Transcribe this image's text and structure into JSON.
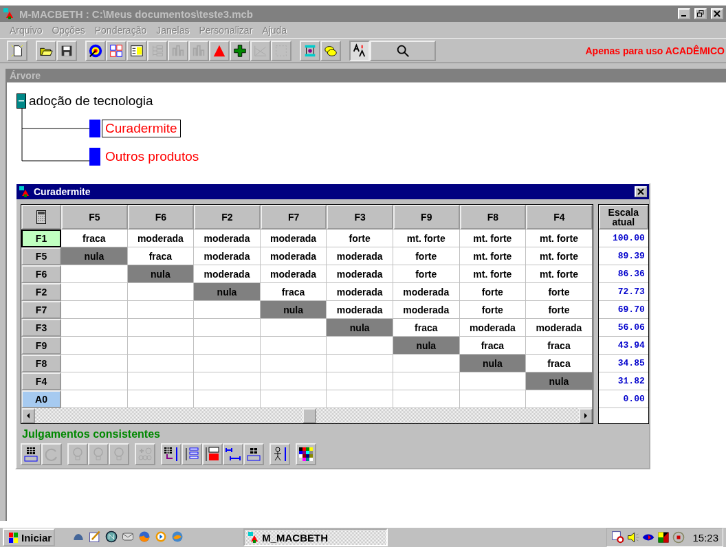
{
  "window": {
    "title": "M-MACBETH : C:\\Meus documentos\\teste3.mcb"
  },
  "menu": [
    "Arquivo",
    "Opções",
    "Ponderação",
    "Janelas",
    "Personalizar",
    "Ajuda"
  ],
  "toolbar": [
    {
      "kind": "new",
      "disabled": false
    },
    {
      "kind": "sep"
    },
    {
      "kind": "open",
      "disabled": false
    },
    {
      "kind": "save",
      "disabled": false
    },
    {
      "kind": "sep"
    },
    {
      "kind": "target",
      "disabled": false
    },
    {
      "kind": "ab",
      "disabled": false
    },
    {
      "kind": "table",
      "disabled": false
    },
    {
      "kind": "tree",
      "disabled": true
    },
    {
      "kind": "bars",
      "disabled": true
    },
    {
      "kind": "bars",
      "disabled": true
    },
    {
      "kind": "triangle",
      "disabled": false
    },
    {
      "kind": "plus",
      "disabled": false
    },
    {
      "kind": "chart",
      "disabled": true
    },
    {
      "kind": "dots",
      "disabled": true
    },
    {
      "kind": "sep"
    },
    {
      "kind": "help",
      "disabled": false
    },
    {
      "kind": "coins",
      "disabled": false
    },
    {
      "kind": "sep"
    },
    {
      "kind": "font",
      "disabled": false
    },
    {
      "kind": "search",
      "disabled": false
    }
  ],
  "notice": "Apenas para uso ACADÊMICO",
  "tree_panel": {
    "title": "Árvore",
    "root": {
      "label": "adoção de tecnologia",
      "expanded": true,
      "children": [
        {
          "label": "Curadermite",
          "selected": true
        },
        {
          "label": "Outros produtos",
          "selected": false
        }
      ]
    }
  },
  "matrix_window": {
    "title": "Curadermite",
    "columns": [
      "F5",
      "F6",
      "F2",
      "F7",
      "F3",
      "F9",
      "F8",
      "F4"
    ],
    "scale_header": "Escala atual",
    "rows": [
      {
        "label": "F1",
        "kind": "active",
        "cells": [
          {
            "text": "fraca",
            "kind": "value"
          },
          {
            "text": "moderada",
            "kind": "value"
          },
          {
            "text": "moderada",
            "kind": "value"
          },
          {
            "text": "moderada",
            "kind": "value"
          },
          {
            "text": "forte",
            "kind": "value"
          },
          {
            "text": "mt. forte",
            "kind": "value"
          },
          {
            "text": "mt. forte",
            "kind": "value"
          },
          {
            "text": "mt. forte",
            "kind": "value"
          }
        ],
        "scale": "100.00"
      },
      {
        "label": "F5",
        "kind": "normal",
        "cells": [
          {
            "text": "nula",
            "kind": "diagonal"
          },
          {
            "text": "fraca",
            "kind": "value"
          },
          {
            "text": "moderada",
            "kind": "value"
          },
          {
            "text": "moderada",
            "kind": "value"
          },
          {
            "text": "moderada",
            "kind": "value"
          },
          {
            "text": "forte",
            "kind": "value"
          },
          {
            "text": "mt. forte",
            "kind": "value"
          },
          {
            "text": "mt. forte",
            "kind": "value"
          }
        ],
        "scale": "89.39"
      },
      {
        "label": "F6",
        "kind": "normal",
        "cells": [
          {
            "kind": "blank"
          },
          {
            "text": "nula",
            "kind": "diagonal"
          },
          {
            "text": "moderada",
            "kind": "value"
          },
          {
            "text": "moderada",
            "kind": "value"
          },
          {
            "text": "moderada",
            "kind": "value"
          },
          {
            "text": "forte",
            "kind": "value"
          },
          {
            "text": "mt. forte",
            "kind": "value"
          },
          {
            "text": "mt. forte",
            "kind": "value"
          }
        ],
        "scale": "86.36"
      },
      {
        "label": "F2",
        "kind": "normal",
        "cells": [
          {
            "kind": "blank"
          },
          {
            "kind": "blank"
          },
          {
            "text": "nula",
            "kind": "diagonal"
          },
          {
            "text": "fraca",
            "kind": "value"
          },
          {
            "text": "moderada",
            "kind": "value"
          },
          {
            "text": "moderada",
            "kind": "value"
          },
          {
            "text": "forte",
            "kind": "value"
          },
          {
            "text": "forte",
            "kind": "value"
          }
        ],
        "scale": "72.73"
      },
      {
        "label": "F7",
        "kind": "normal",
        "cells": [
          {
            "kind": "blank"
          },
          {
            "kind": "blank"
          },
          {
            "kind": "blank"
          },
          {
            "text": "nula",
            "kind": "diagonal"
          },
          {
            "text": "moderada",
            "kind": "value"
          },
          {
            "text": "moderada",
            "kind": "value"
          },
          {
            "text": "forte",
            "kind": "value"
          },
          {
            "text": "forte",
            "kind": "value"
          }
        ],
        "scale": "69.70"
      },
      {
        "label": "F3",
        "kind": "normal",
        "cells": [
          {
            "kind": "blank"
          },
          {
            "kind": "blank"
          },
          {
            "kind": "blank"
          },
          {
            "kind": "blank"
          },
          {
            "text": "nula",
            "kind": "diagonal"
          },
          {
            "text": "fraca",
            "kind": "value"
          },
          {
            "text": "moderada",
            "kind": "value"
          },
          {
            "text": "moderada",
            "kind": "value"
          }
        ],
        "scale": "56.06"
      },
      {
        "label": "F9",
        "kind": "normal",
        "cells": [
          {
            "kind": "blank"
          },
          {
            "kind": "blank"
          },
          {
            "kind": "blank"
          },
          {
            "kind": "blank"
          },
          {
            "kind": "blank"
          },
          {
            "text": "nula",
            "kind": "diagonal"
          },
          {
            "text": "fraca",
            "kind": "value"
          },
          {
            "text": "fraca",
            "kind": "value"
          }
        ],
        "scale": "43.94"
      },
      {
        "label": "F8",
        "kind": "normal",
        "cells": [
          {
            "kind": "blank"
          },
          {
            "kind": "blank"
          },
          {
            "kind": "blank"
          },
          {
            "kind": "blank"
          },
          {
            "kind": "blank"
          },
          {
            "kind": "blank"
          },
          {
            "text": "nula",
            "kind": "diagonal"
          },
          {
            "text": "fraca",
            "kind": "value"
          }
        ],
        "scale": "34.85"
      },
      {
        "label": "F4",
        "kind": "normal",
        "cells": [
          {
            "kind": "blank"
          },
          {
            "kind": "blank"
          },
          {
            "kind": "blank"
          },
          {
            "kind": "blank"
          },
          {
            "kind": "blank"
          },
          {
            "kind": "blank"
          },
          {
            "kind": "blank"
          },
          {
            "text": "nula",
            "kind": "diagonal"
          }
        ],
        "scale": "31.82"
      },
      {
        "label": "A0",
        "kind": "anchor",
        "cells": [
          {
            "kind": "blank"
          },
          {
            "kind": "blank"
          },
          {
            "kind": "blank"
          },
          {
            "kind": "blank"
          },
          {
            "kind": "blank"
          },
          {
            "kind": "blank"
          },
          {
            "kind": "blank"
          },
          {
            "kind": "blank"
          }
        ],
        "scale": "0.00"
      }
    ],
    "status": "Julgamentos consistentes",
    "tools": [
      {
        "kind": "grid-check",
        "disabled": false
      },
      {
        "kind": "refresh",
        "disabled": true
      },
      {
        "kind": "sep"
      },
      {
        "kind": "bulb",
        "disabled": true
      },
      {
        "kind": "bulb-arrow",
        "disabled": true
      },
      {
        "kind": "bulb-ok",
        "disabled": true
      },
      {
        "kind": "sep"
      },
      {
        "kind": "bulbs",
        "disabled": true
      },
      {
        "kind": "sep"
      },
      {
        "kind": "grid-arrow",
        "disabled": false
      },
      {
        "kind": "tree-scale",
        "disabled": false
      },
      {
        "kind": "macbeth-scale",
        "disabled": false
      },
      {
        "kind": "ruler",
        "disabled": false
      },
      {
        "kind": "diff",
        "disabled": false
      },
      {
        "kind": "sep"
      },
      {
        "kind": "figure",
        "disabled": false
      },
      {
        "kind": "sep"
      },
      {
        "kind": "palette",
        "disabled": false
      }
    ]
  },
  "taskbar": {
    "start": "Iniciar",
    "task": "M_MACBETH",
    "clock": "15:23"
  }
}
